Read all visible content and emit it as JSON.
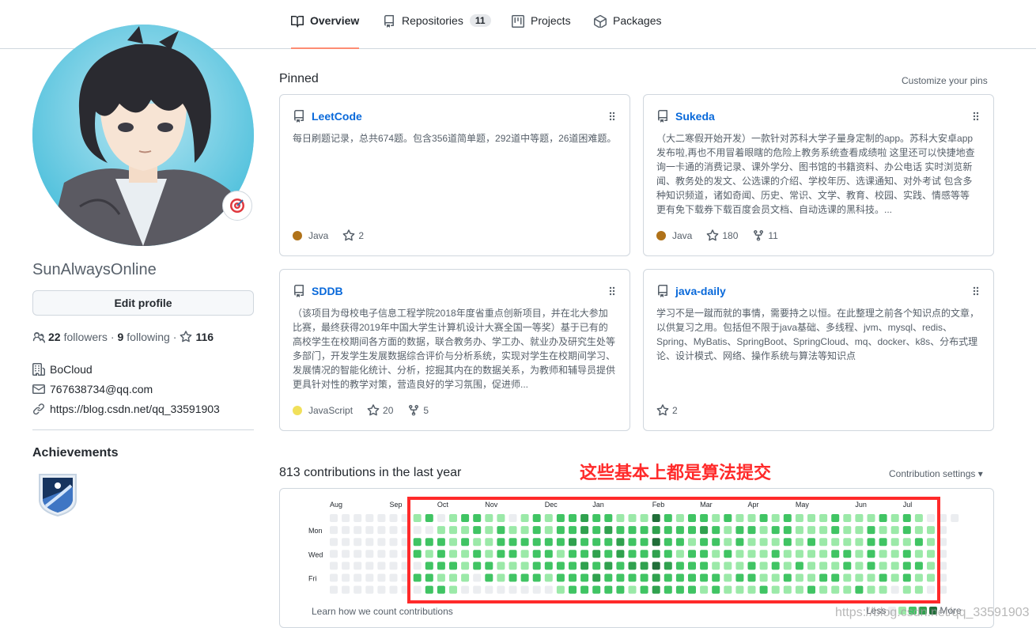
{
  "nav": {
    "tabs": [
      {
        "label": "Overview",
        "icon": "book-icon",
        "active": true
      },
      {
        "label": "Repositories",
        "icon": "repo-icon",
        "count": "11"
      },
      {
        "label": "Projects",
        "icon": "project-icon"
      },
      {
        "label": "Packages",
        "icon": "package-icon"
      }
    ]
  },
  "profile": {
    "username": "SunAlwaysOnline",
    "edit_label": "Edit profile",
    "followers_count": "22",
    "followers_label": "followers",
    "following_count": "9",
    "following_label": "following",
    "stars_count": "116",
    "company": "BoCloud",
    "email": "767638734@qq.com",
    "website": "https://blog.csdn.net/qq_33591903",
    "achievements_label": "Achievements"
  },
  "pinned": {
    "title": "Pinned",
    "customize_label": "Customize your pins",
    "repos": [
      {
        "name": "LeetCode",
        "description": "每日刷题记录，总共674题。包含356道简单题，292道中等题，26道困难题。",
        "language": "Java",
        "language_color": "#b07219",
        "stars": "2",
        "forks": ""
      },
      {
        "name": "Sukeda",
        "description": "（大二寒假开始开发）一款针对苏科大学子量身定制的app。苏科大安卓app发布啦,再也不用冒着眼瞎的危险上教务系统查看成绩啦 这里还可以快捷地查询一卡通的消费记录、课外学分、图书馆的书籍资料、办公电话 实时浏览新闻、教务处的发文、公选课的介绍、学校年历、选课通知、对外考试 包含多种知识频道，诸如奇闻、历史、常识、文学、教育、校园、实践、情感等等 更有免下载券下载百度会员文档、自动选课的黑科技。...",
        "language": "Java",
        "language_color": "#b07219",
        "stars": "180",
        "forks": "11"
      },
      {
        "name": "SDDB",
        "description": "（该项目为母校电子信息工程学院2018年度省重点创新项目，并在北大参加比赛，最终获得2019年中国大学生计算机设计大赛全国一等奖）基于已有的高校学生在校期间各方面的数据，联合教务办、学工办、就业办及研究生处等多部门，开发学生发展数据综合评价与分析系统，实现对学生在校期间学习、发展情况的智能化统计、分析，挖掘其内在的数据关系，为教师和辅导员提供更具针对性的教学对策，营造良好的学习氛围，促进师...",
        "language": "JavaScript",
        "language_color": "#f1e05a",
        "stars": "20",
        "forks": "5"
      },
      {
        "name": "java-daily",
        "description": "学习不是一蹴而就的事情，需要持之以恒。在此整理之前各个知识点的文章，以供复习之用。包括但不限于java基础、多线程、jvm、mysql、redis、Spring、MyBatis、SpringBoot、SpringCloud、mq、docker、k8s、分布式理论、设计模式、网络、操作系统与算法等知识点",
        "language": "",
        "language_color": "",
        "stars": "2",
        "forks": ""
      }
    ]
  },
  "contributions": {
    "title": "813 contributions in the last year",
    "annotation": "这些基本上都是算法提交",
    "settings_label": "Contribution settings ▾",
    "learn_label": "Learn how we count contributions",
    "legend_less": "Less",
    "legend_more": "More",
    "months": [
      {
        "label": "Aug",
        "week": 0
      },
      {
        "label": "Sep",
        "week": 5
      },
      {
        "label": "Oct",
        "week": 9
      },
      {
        "label": "Nov",
        "week": 13
      },
      {
        "label": "Dec",
        "week": 18
      },
      {
        "label": "Jan",
        "week": 22
      },
      {
        "label": "Feb",
        "week": 27
      },
      {
        "label": "Mar",
        "week": 31
      },
      {
        "label": "Apr",
        "week": 35
      },
      {
        "label": "May",
        "week": 39
      },
      {
        "label": "Jun",
        "week": 44
      },
      {
        "label": "Jul",
        "week": 48
      }
    ],
    "day_labels": [
      "Mon",
      "Wed",
      "Fri"
    ],
    "colors": [
      "#ebedf0",
      "#9be9a8",
      "#40c463",
      "#30a14e",
      "#216e39"
    ],
    "weeks": [
      [
        0,
        0,
        0,
        0,
        0,
        0,
        0
      ],
      [
        0,
        0,
        0,
        0,
        0,
        0,
        0
      ],
      [
        0,
        0,
        0,
        0,
        0,
        0,
        0
      ],
      [
        0,
        0,
        0,
        0,
        0,
        0,
        0
      ],
      [
        0,
        0,
        0,
        0,
        0,
        0,
        0
      ],
      [
        0,
        0,
        0,
        0,
        0,
        0,
        0
      ],
      [
        0,
        0,
        0,
        0,
        0,
        0,
        0
      ],
      [
        1,
        0,
        2,
        2,
        0,
        2,
        0
      ],
      [
        2,
        0,
        2,
        1,
        2,
        2,
        2
      ],
      [
        0,
        1,
        2,
        2,
        2,
        1,
        2
      ],
      [
        1,
        1,
        1,
        1,
        2,
        1,
        1
      ],
      [
        2,
        1,
        2,
        1,
        1,
        1,
        0
      ],
      [
        2,
        2,
        1,
        2,
        2,
        0,
        0
      ],
      [
        1,
        1,
        1,
        1,
        2,
        2,
        0
      ],
      [
        1,
        2,
        2,
        2,
        1,
        1,
        0
      ],
      [
        0,
        1,
        2,
        2,
        1,
        2,
        0
      ],
      [
        1,
        1,
        2,
        1,
        1,
        2,
        0
      ],
      [
        2,
        2,
        2,
        2,
        2,
        2,
        0
      ],
      [
        1,
        1,
        2,
        2,
        2,
        1,
        0
      ],
      [
        2,
        2,
        2,
        1,
        2,
        2,
        1
      ],
      [
        2,
        2,
        3,
        2,
        2,
        2,
        2
      ],
      [
        3,
        3,
        2,
        2,
        3,
        2,
        2
      ],
      [
        2,
        2,
        2,
        3,
        2,
        3,
        2
      ],
      [
        2,
        3,
        2,
        2,
        3,
        2,
        2
      ],
      [
        1,
        2,
        3,
        3,
        2,
        2,
        2
      ],
      [
        1,
        2,
        2,
        2,
        3,
        2,
        1
      ],
      [
        1,
        2,
        2,
        2,
        3,
        2,
        2
      ],
      [
        4,
        3,
        4,
        3,
        4,
        3,
        3
      ],
      [
        2,
        2,
        2,
        2,
        3,
        2,
        2
      ],
      [
        1,
        2,
        2,
        1,
        2,
        2,
        2
      ],
      [
        2,
        2,
        1,
        2,
        2,
        2,
        2
      ],
      [
        2,
        3,
        2,
        2,
        2,
        2,
        1
      ],
      [
        1,
        2,
        2,
        1,
        1,
        2,
        2
      ],
      [
        2,
        1,
        1,
        2,
        1,
        1,
        1
      ],
      [
        1,
        2,
        2,
        1,
        1,
        2,
        1
      ],
      [
        1,
        2,
        1,
        1,
        2,
        2,
        1
      ],
      [
        2,
        1,
        1,
        1,
        1,
        1,
        2
      ],
      [
        1,
        2,
        1,
        2,
        2,
        1,
        1
      ],
      [
        2,
        2,
        2,
        1,
        1,
        2,
        1
      ],
      [
        1,
        1,
        1,
        1,
        2,
        1,
        1
      ],
      [
        1,
        1,
        2,
        1,
        1,
        1,
        2
      ],
      [
        1,
        1,
        1,
        1,
        1,
        2,
        1
      ],
      [
        2,
        2,
        1,
        2,
        1,
        2,
        1
      ],
      [
        1,
        1,
        1,
        2,
        2,
        1,
        1
      ],
      [
        1,
        1,
        1,
        1,
        1,
        1,
        2
      ],
      [
        1,
        2,
        2,
        2,
        2,
        1,
        1
      ],
      [
        2,
        1,
        2,
        1,
        1,
        2,
        1
      ],
      [
        1,
        1,
        1,
        1,
        1,
        1,
        0
      ],
      [
        2,
        2,
        1,
        2,
        2,
        2,
        1
      ],
      [
        1,
        1,
        2,
        1,
        2,
        1,
        1
      ],
      [
        0,
        1,
        1,
        1,
        1,
        1,
        0
      ],
      [
        0,
        0,
        0,
        0,
        0,
        0,
        0
      ],
      [
        0
      ]
    ]
  }
}
